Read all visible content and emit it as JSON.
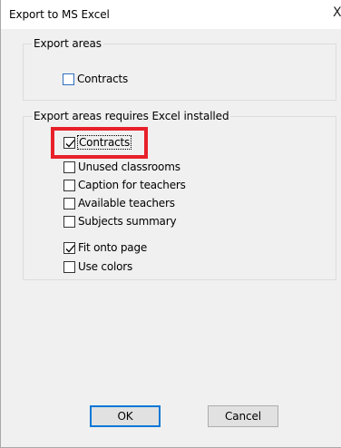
{
  "window": {
    "title": "Export to MS Excel",
    "close_glyph": "X"
  },
  "group1": {
    "label": "Export areas",
    "items": [
      {
        "label": "Contracts",
        "checked": false
      }
    ]
  },
  "group2": {
    "label": "Export areas requires Excel installed",
    "items": [
      {
        "label": "Contracts",
        "checked": true,
        "focused": true,
        "highlighted": true
      },
      {
        "label": "Unused classrooms",
        "checked": false
      },
      {
        "label": "Caption for teachers",
        "checked": false
      },
      {
        "label": "Available teachers",
        "checked": false
      },
      {
        "label": "Subjects summary",
        "checked": false
      }
    ],
    "options": [
      {
        "label": "Fit onto page",
        "checked": true
      },
      {
        "label": "Use colors",
        "checked": false
      }
    ]
  },
  "buttons": {
    "ok_label": "OK",
    "cancel_label": "Cancel"
  },
  "colors": {
    "highlight": "#e8202a",
    "default_button_border": "#0078d7",
    "checkbox_border": "#333333"
  }
}
